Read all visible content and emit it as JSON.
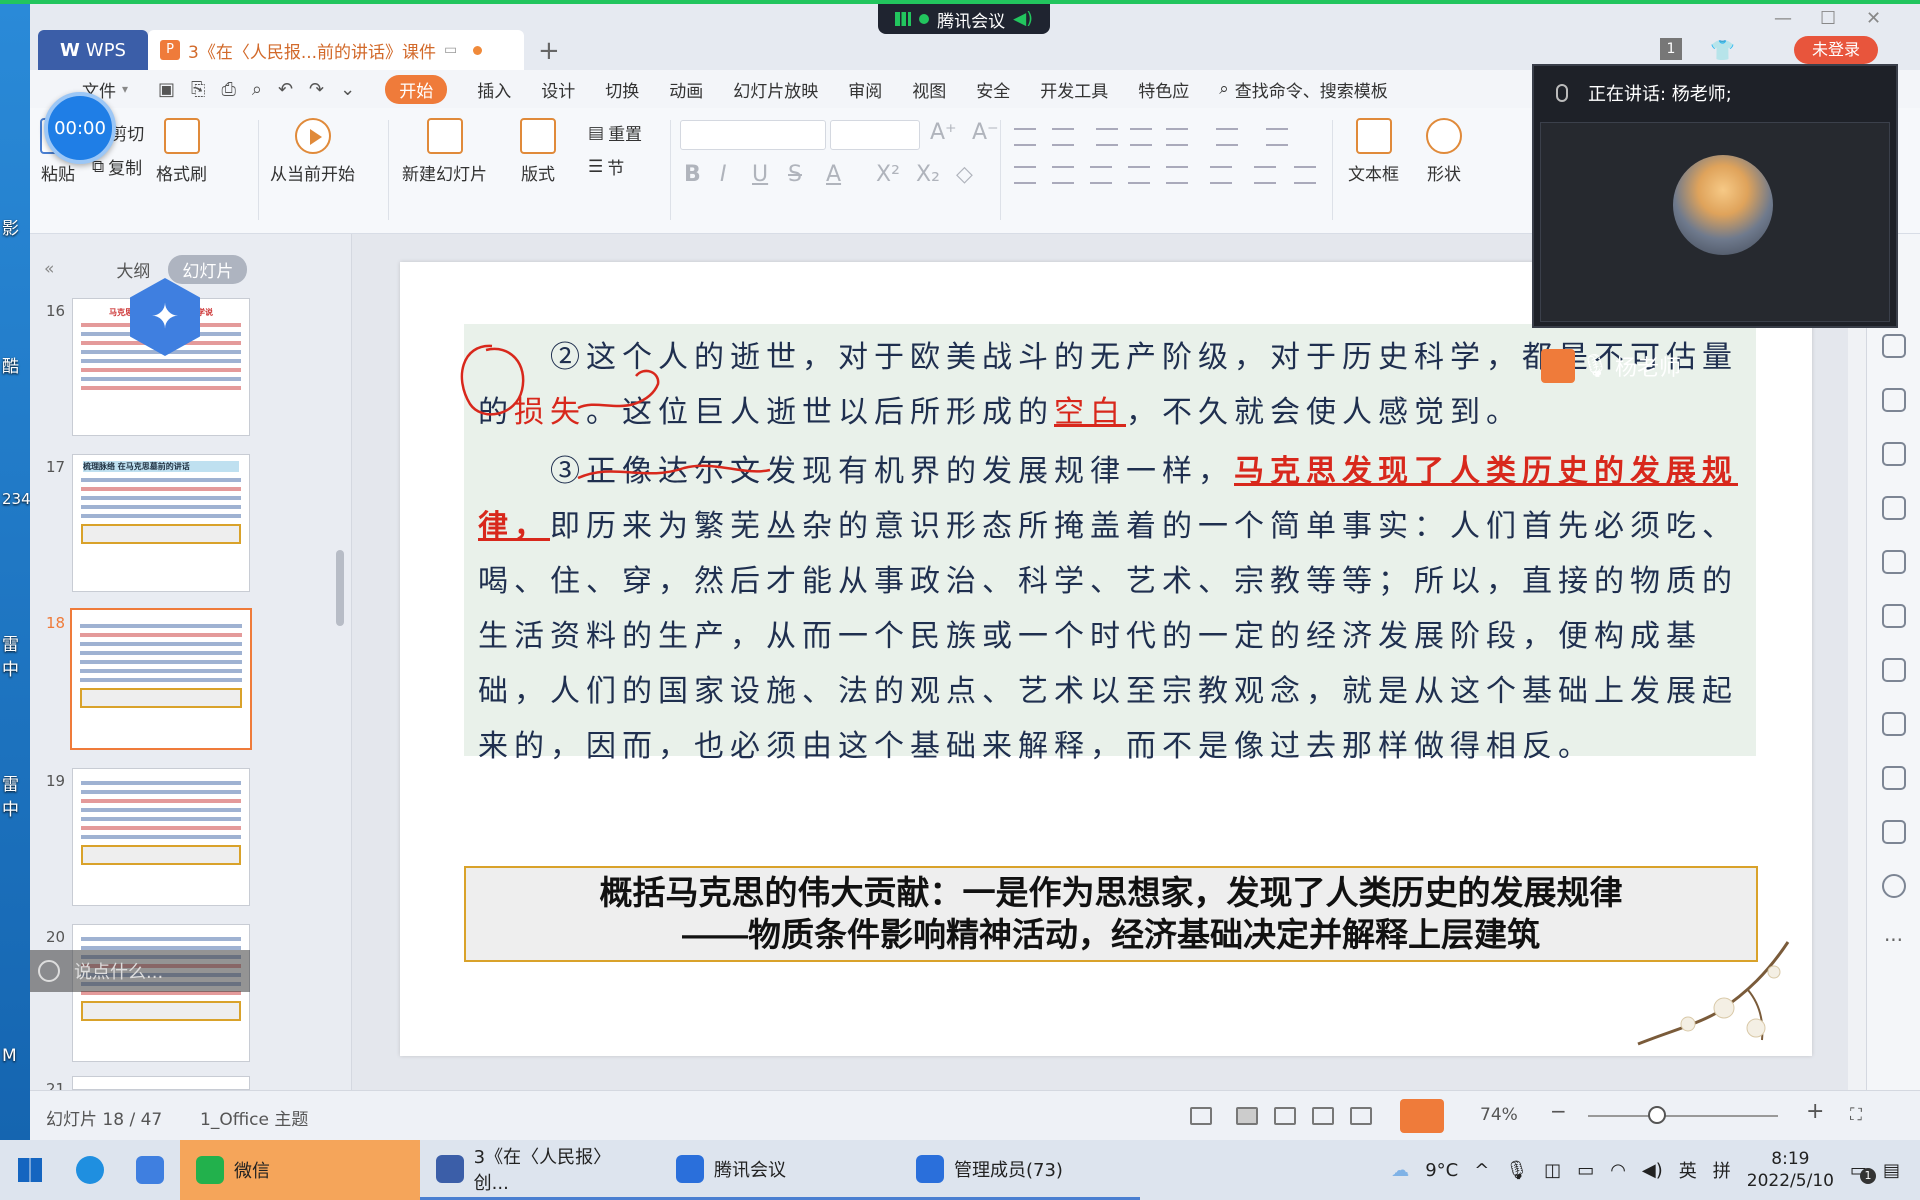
{
  "desktop": {
    "labels": [
      "影",
      "酷",
      "234",
      "雷中",
      "雷中",
      "M"
    ]
  },
  "window": {
    "tabs": {
      "wps": "WPS",
      "doc": "3《在〈人民报...前的讲话》课件"
    },
    "meeting_pill": "腾讯会议",
    "login": "未登录",
    "page_badge": "1"
  },
  "timer": "00:00",
  "menu": {
    "file": "文件",
    "items": [
      "开始",
      "插入",
      "设计",
      "切换",
      "动画",
      "幻灯片放映",
      "审阅",
      "视图",
      "安全",
      "开发工具",
      "特色应"
    ],
    "search": "查找命令、搜索模板"
  },
  "ribbon": {
    "paste": "粘贴",
    "cut": "剪切",
    "copy": "复制",
    "format_painter": "格式刷",
    "play_from_current": "从当前开始",
    "new_slide": "新建幻灯片",
    "layout": "版式",
    "reset": "重置",
    "section": "节",
    "textbox": "文本框",
    "shape": "形状"
  },
  "thumb_pane": {
    "tabs": [
      "大纲",
      "幻灯片"
    ],
    "slides": [
      {
        "num": "16",
        "title": "马克思主义是关于什么的学说"
      },
      {
        "num": "17",
        "title": "梳理脉络 在马克思墓前的讲话"
      },
      {
        "num": "18",
        "title": ""
      },
      {
        "num": "19",
        "title": ""
      },
      {
        "num": "20",
        "title": ""
      },
      {
        "num": "21",
        "title": ""
      }
    ],
    "chat_placeholder": "说点什么..."
  },
  "slide": {
    "para1": {
      "num": "②",
      "text_a": "这个人的逝世，对于欧美战斗的无产阶级，对于历史科学，都是不可估量的",
      "red1": "损失",
      "text_b": "。这位巨人逝世以后所形成的",
      "red2": "空白",
      "text_c": "，不久就会使人感觉到。"
    },
    "para2": {
      "num": "③",
      "text_a": "正像达尔文发现有机界的发展规律一样，",
      "red": "马克思发现了人类历史的发展规律，",
      "text_b": "即历来为繁芜丛杂的意识形态所掩盖着的一个简单事实：人们首先必须吃、喝、住、穿，然后才能从事政治、科学、艺术、宗教等等；所以，直接的物质的生活资料的生产，从而一个民族或一个时代的一定的经济发展阶段，便构成基础，人们的国家设施、法的观点、艺术以至宗教观念，就是从这个基础上发展起来的，因而，也必须由这个基础来解释，而不是像过去那样做得相反。"
    },
    "summary": {
      "line1": "概括马克思的伟大贡献：一是作为思想家，发现了人类历史的发展规律",
      "line2": "——物质条件影响精神活动，经济基础决定并解释上层建筑"
    }
  },
  "meeting": {
    "speaking": "正在讲话: 杨老师;",
    "name": "杨老师"
  },
  "statusbar": {
    "slide_count": "幻灯片 18 / 47",
    "theme": "1_Office 主题",
    "zoom": "74%",
    "zoom_level": 0.74
  },
  "taskbar": {
    "apps": [
      "微信",
      "3《在〈人民报〉创...",
      "腾讯会议",
      "管理成员(73)"
    ],
    "weather": "9°C",
    "ime": "英",
    "ime2": "拼",
    "time": "8:19",
    "date": "2022/5/10",
    "notif": "1"
  },
  "colors": {
    "accent": "#ef7b3a",
    "red_text": "#d8281c",
    "body_text": "#1f2f4f",
    "gold_border": "#d9a22a"
  }
}
